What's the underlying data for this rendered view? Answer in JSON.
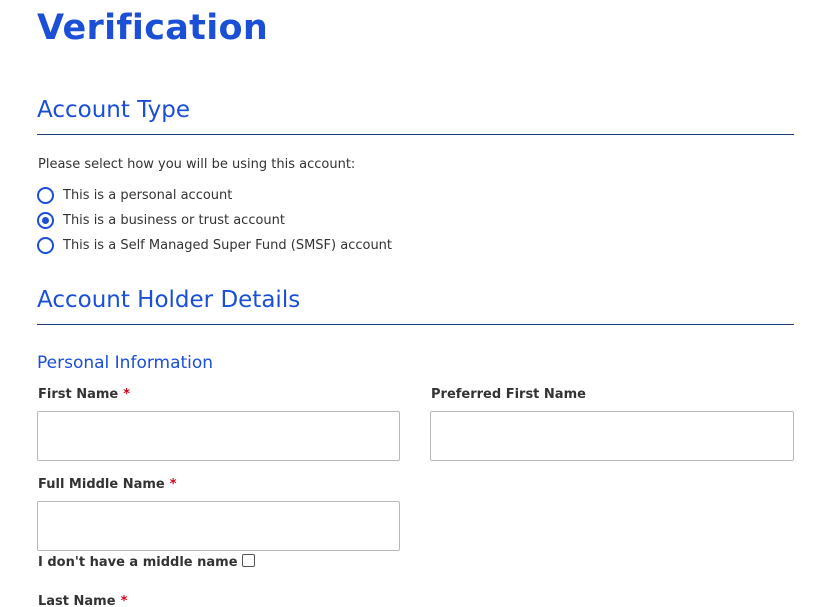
{
  "page": {
    "title": "Verification"
  },
  "account_type": {
    "heading": "Account Type",
    "prompt": "Please select how you will be using this account:",
    "options": [
      {
        "label": "This is a personal account",
        "selected": false
      },
      {
        "label": "This is a business or trust account",
        "selected": true
      },
      {
        "label": "This is a Self Managed Super Fund (SMSF) account",
        "selected": false
      }
    ]
  },
  "holder_details": {
    "heading": "Account Holder Details",
    "personal_info_heading": "Personal Information",
    "required_marker": "*",
    "first_name": {
      "label": "First Name",
      "value": ""
    },
    "preferred_first_name": {
      "label": "Preferred First Name",
      "value": ""
    },
    "middle_name": {
      "label": "Full Middle Name",
      "value": ""
    },
    "no_middle_name": {
      "label": "I don't have a middle name",
      "checked": false
    },
    "last_name": {
      "label": "Last Name"
    }
  },
  "colors": {
    "accent": "#1a4fd6",
    "rule": "#1f3f7a",
    "required": "#d0021b",
    "text": "#333333"
  }
}
